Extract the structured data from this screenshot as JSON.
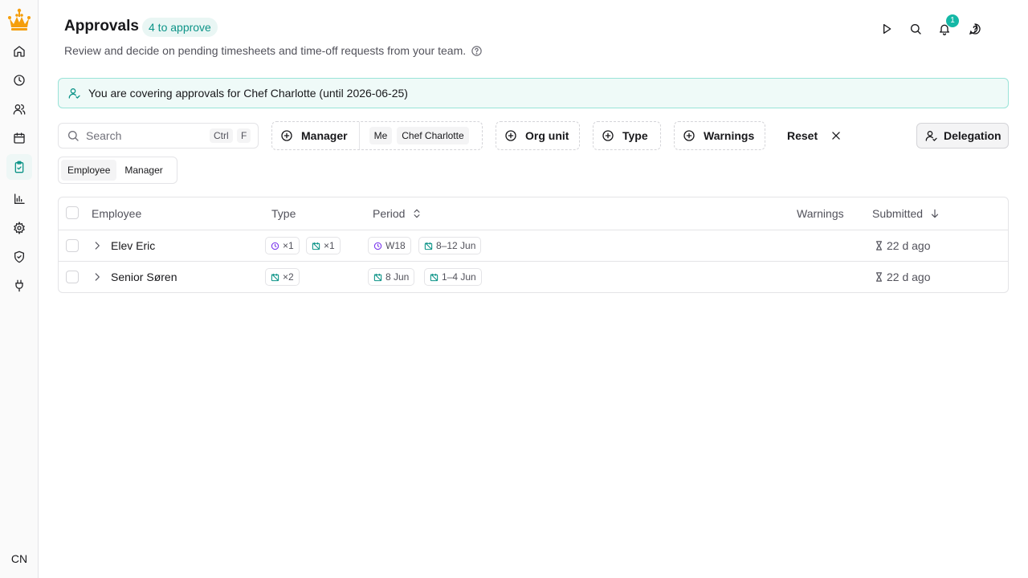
{
  "sidebar": {
    "logo": "crown-logo",
    "items": [
      {
        "icon": "home-icon",
        "name": "home"
      },
      {
        "icon": "clock-icon",
        "name": "timesheets"
      },
      {
        "icon": "users-icon",
        "name": "team"
      },
      {
        "icon": "calendar-icon",
        "name": "calendar"
      },
      {
        "icon": "clipboard-check-icon",
        "name": "approvals",
        "active": true
      },
      {
        "icon": "chart-icon",
        "name": "reports"
      },
      {
        "icon": "gear-icon",
        "name": "settings"
      },
      {
        "icon": "shield-check-icon",
        "name": "security"
      },
      {
        "icon": "plug-icon",
        "name": "integrations"
      }
    ],
    "avatar_initials": "CN"
  },
  "header": {
    "title": "Approvals",
    "badge": "4 to approve",
    "subtitle": "Review and decide on pending timesheets and time-off requests from your team.",
    "notification_count": "1",
    "icons": [
      "play-icon",
      "search-icon",
      "bell-icon",
      "help-icon"
    ]
  },
  "banner": {
    "text": "You are covering approvals for Chef Charlotte (until 2026-06-25)"
  },
  "filters": {
    "search_placeholder": "Search",
    "shortcut_key1": "Ctrl",
    "shortcut_key2": "F",
    "manager_label": "Manager",
    "manager_pills": [
      "Me",
      "Chef Charlotte"
    ],
    "org_unit_label": "Org unit",
    "type_label": "Type",
    "warnings_label": "Warnings",
    "reset_label": "Reset",
    "delegation_label": "Delegation"
  },
  "view_toggle": {
    "options": [
      "Employee",
      "Manager"
    ],
    "selected": "Employee"
  },
  "table": {
    "columns": {
      "employee": "Employee",
      "type": "Type",
      "period": "Period",
      "warnings": "Warnings",
      "submitted": "Submitted"
    },
    "rows": [
      {
        "employee": "Elev Eric",
        "type_tags": [
          "×1",
          "×1"
        ],
        "period_tags": [
          "W18",
          "8–12 Jun"
        ],
        "warnings": "",
        "submitted": "22 d ago"
      },
      {
        "employee": "Senior Søren",
        "type_tags": [
          "×2"
        ],
        "period_tags": [
          "8 Jun",
          "1–4 Jun"
        ],
        "warnings": "",
        "submitted": "22 d ago"
      }
    ]
  },
  "colors": {
    "accent": "#0d9488",
    "accent_bg": "#effaf8",
    "badge_bg": "#e9f6f4",
    "logo": "#f59e0b",
    "timesheet_icon": "#7c3aed"
  }
}
